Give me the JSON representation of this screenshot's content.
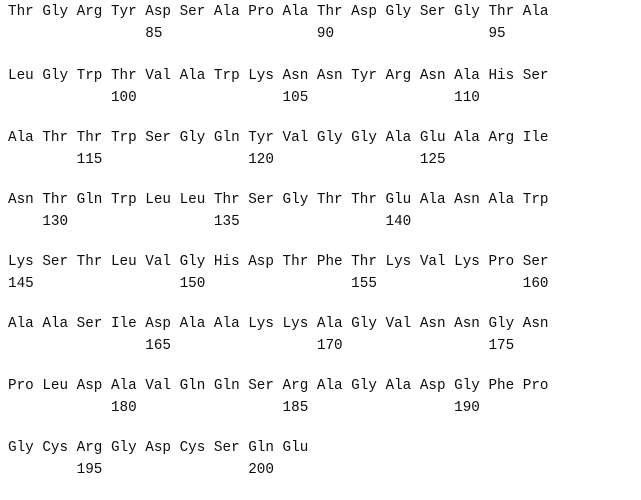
{
  "document": {
    "type": "sequence-listing",
    "residue_width_chars": 4,
    "blocks": [
      {
        "residues": [
          "Thr",
          "Gly",
          "Arg",
          "Tyr",
          "Asp",
          "Ser",
          "Ala",
          "Pro",
          "Ala",
          "Thr",
          "Asp",
          "Gly",
          "Ser",
          "Gly",
          "Thr",
          "Ala"
        ],
        "numbers": [
          {
            "label": "85",
            "position": 5
          },
          {
            "label": "90",
            "position": 10
          },
          {
            "label": "95",
            "position": 15
          }
        ],
        "residue_text": "Thr Gly Arg Tyr Asp Ser Ala Pro Ala Thr Asp Gly Ser Gly Thr Ala",
        "number_text": "                85                  90                  95"
      },
      {
        "residues": [
          "Leu",
          "Gly",
          "Trp",
          "Thr",
          "Val",
          "Ala",
          "Trp",
          "Lys",
          "Asn",
          "Asn",
          "Tyr",
          "Arg",
          "Asn",
          "Ala",
          "His",
          "Ser"
        ],
        "numbers": [
          {
            "label": "100",
            "position": 4
          },
          {
            "label": "105",
            "position": 9
          },
          {
            "label": "110",
            "position": 14
          }
        ],
        "residue_text": "Leu Gly Trp Thr Val Ala Trp Lys Asn Asn Tyr Arg Asn Ala His Ser",
        "number_text": "            100                 105                 110"
      },
      {
        "residues": [
          "Ala",
          "Thr",
          "Thr",
          "Trp",
          "Ser",
          "Gly",
          "Gln",
          "Tyr",
          "Val",
          "Gly",
          "Gly",
          "Ala",
          "Glu",
          "Ala",
          "Arg",
          "Ile"
        ],
        "numbers": [
          {
            "label": "115",
            "position": 3
          },
          {
            "label": "120",
            "position": 8
          },
          {
            "label": "125",
            "position": 13
          }
        ],
        "residue_text": "Ala Thr Thr Trp Ser Gly Gln Tyr Val Gly Gly Ala Glu Ala Arg Ile",
        "number_text": "        115                 120                 125"
      },
      {
        "residues": [
          "Asn",
          "Thr",
          "Gln",
          "Trp",
          "Leu",
          "Leu",
          "Thr",
          "Ser",
          "Gly",
          "Thr",
          "Thr",
          "Glu",
          "Ala",
          "Asn",
          "Ala",
          "Trp"
        ],
        "numbers": [
          {
            "label": "130",
            "position": 2
          },
          {
            "label": "135",
            "position": 7
          },
          {
            "label": "140",
            "position": 12
          }
        ],
        "residue_text": "Asn Thr Gln Trp Leu Leu Thr Ser Gly Thr Thr Glu Ala Asn Ala Trp",
        "number_text": "    130                 135                 140"
      },
      {
        "residues": [
          "Lys",
          "Ser",
          "Thr",
          "Leu",
          "Val",
          "Gly",
          "His",
          "Asp",
          "Thr",
          "Phe",
          "Thr",
          "Lys",
          "Val",
          "Lys",
          "Pro",
          "Ser"
        ],
        "numbers": [
          {
            "label": "145",
            "position": 1
          },
          {
            "label": "150",
            "position": 6
          },
          {
            "label": "155",
            "position": 11
          },
          {
            "label": "160",
            "position": 16
          }
        ],
        "residue_text": "Lys Ser Thr Leu Val Gly His Asp Thr Phe Thr Lys Val Lys Pro Ser",
        "number_text": "145                 150                 155                 160"
      },
      {
        "residues": [
          "Ala",
          "Ala",
          "Ser",
          "Ile",
          "Asp",
          "Ala",
          "Ala",
          "Lys",
          "Lys",
          "Ala",
          "Gly",
          "Val",
          "Asn",
          "Asn",
          "Gly",
          "Asn"
        ],
        "numbers": [
          {
            "label": "165",
            "position": 5
          },
          {
            "label": "170",
            "position": 10
          },
          {
            "label": "175",
            "position": 15
          }
        ],
        "residue_text": "Ala Ala Ser Ile Asp Ala Ala Lys Lys Ala Gly Val Asn Asn Gly Asn",
        "number_text": "                165                 170                 175"
      },
      {
        "residues": [
          "Pro",
          "Leu",
          "Asp",
          "Ala",
          "Val",
          "Gln",
          "Gln",
          "Ser",
          "Arg",
          "Ala",
          "Gly",
          "Ala",
          "Asp",
          "Gly",
          "Phe",
          "Pro"
        ],
        "numbers": [
          {
            "label": "180",
            "position": 4
          },
          {
            "label": "185",
            "position": 9
          },
          {
            "label": "190",
            "position": 14
          }
        ],
        "residue_text": "Pro Leu Asp Ala Val Gln Gln Ser Arg Ala Gly Ala Asp Gly Phe Pro",
        "number_text": "            180                 185                 190"
      },
      {
        "residues": [
          "Gly",
          "Cys",
          "Arg",
          "Gly",
          "Asp",
          "Cys",
          "Ser",
          "Gln",
          "Glu"
        ],
        "numbers": [
          {
            "label": "195",
            "position": 3
          },
          {
            "label": "200",
            "position": 8
          }
        ],
        "residue_text": "Gly Cys Arg Gly Asp Cys Ser Gln Glu",
        "number_text": "        195                 200"
      }
    ]
  }
}
